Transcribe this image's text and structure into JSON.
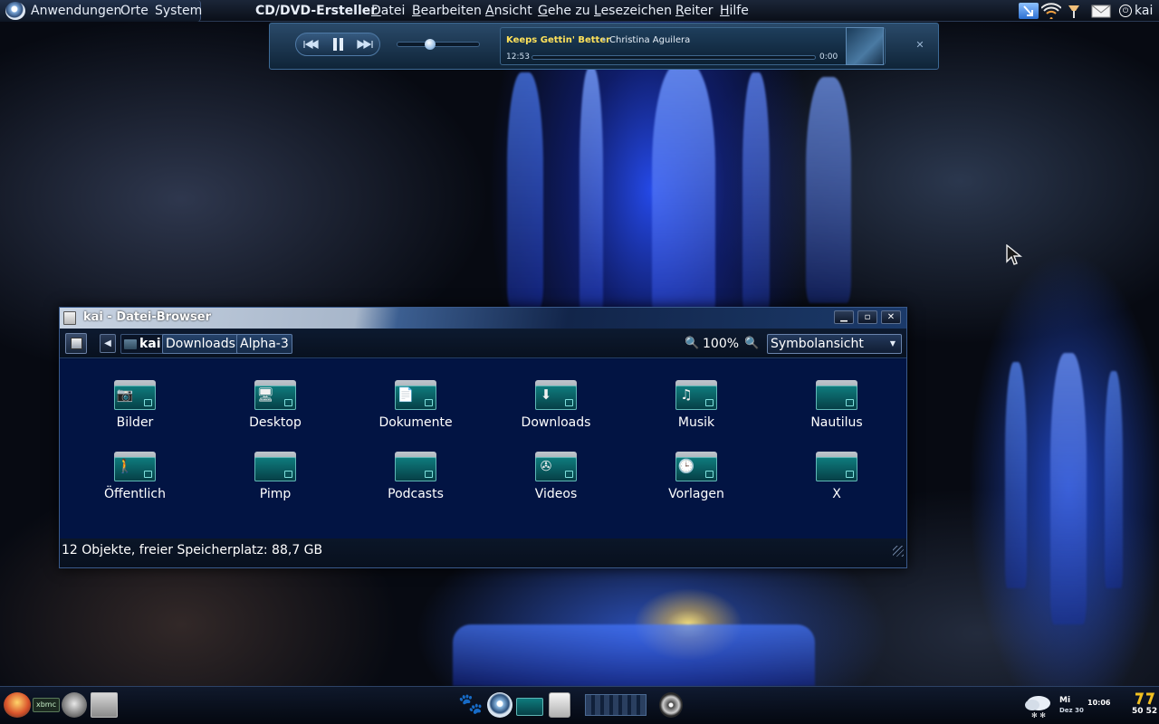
{
  "top_panel": {
    "menus": [
      "Anwendungen",
      "Orte",
      "System"
    ],
    "app_name": "CD/DVD-Ersteller",
    "app_menu": [
      {
        "first": "D",
        "rest": "atei"
      },
      {
        "first": "B",
        "rest": "earbeiten"
      },
      {
        "first": "A",
        "rest": "nsicht"
      },
      {
        "first": "G",
        "rest": "ehe zu"
      },
      {
        "first": "L",
        "rest": "esezeichen"
      },
      {
        "first": "R",
        "rest": "eiter"
      },
      {
        "first": "H",
        "rest": "ilfe"
      }
    ],
    "user": "kai"
  },
  "player": {
    "title": "Keeps Gettin' Better",
    "separator": "•",
    "artist": "Christina Aguilera",
    "time_elapsed": "12:53",
    "time_total": "0:00",
    "volume_fraction": 0.4,
    "progress_fraction": 0.0
  },
  "window": {
    "title": "kai - Datei-Browser",
    "breadcrumbs": [
      "kai",
      "Downloads",
      "Alpha-3"
    ],
    "zoom": "100%",
    "view_mode": "Symbolansicht",
    "folders": [
      {
        "name": "Bilder",
        "emblem": "camera-icon",
        "glyph": "📷"
      },
      {
        "name": "Desktop",
        "emblem": "desktop-icon",
        "glyph": "🖥"
      },
      {
        "name": "Dokumente",
        "emblem": "document-icon",
        "glyph": "📄"
      },
      {
        "name": "Downloads",
        "emblem": "download-icon",
        "glyph": "⬇"
      },
      {
        "name": "Musik",
        "emblem": "music-player-icon",
        "glyph": "♫"
      },
      {
        "name": "Nautilus",
        "emblem": "",
        "glyph": ""
      },
      {
        "name": "Öffentlich",
        "emblem": "person-icon",
        "glyph": "🚶"
      },
      {
        "name": "Pimp",
        "emblem": "",
        "glyph": ""
      },
      {
        "name": "Podcasts",
        "emblem": "",
        "glyph": ""
      },
      {
        "name": "Videos",
        "emblem": "film-reel-icon",
        "glyph": "✇"
      },
      {
        "name": "Vorlagen",
        "emblem": "clock-icon",
        "glyph": "🕒"
      },
      {
        "name": "X",
        "emblem": "",
        "glyph": ""
      }
    ],
    "status": "12 Objekte, freier Speicherplatz: 88,7 GB"
  },
  "bottom_panel": {
    "launcher_label": "xbmc",
    "clock_day": "Mi",
    "clock_date": "Dez 30",
    "clock_time": "10:06",
    "cpu_value": "50 52"
  },
  "colors": {
    "window_bg": "#021443",
    "folder_front": "#0e7b7d",
    "player_title": "#ffe25a",
    "accent": "#3a5a8c"
  }
}
